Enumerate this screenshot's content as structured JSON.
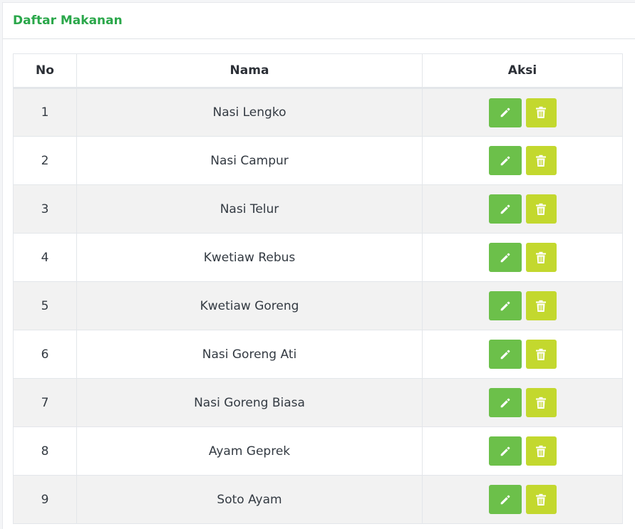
{
  "card": {
    "title": "Daftar Makanan"
  },
  "table": {
    "headers": {
      "no": "No",
      "nama": "Nama",
      "aksi": "Aksi"
    },
    "rows": [
      {
        "no": "1",
        "nama": "Nasi Lengko"
      },
      {
        "no": "2",
        "nama": "Nasi Campur"
      },
      {
        "no": "3",
        "nama": "Nasi Telur"
      },
      {
        "no": "4",
        "nama": "Kwetiaw Rebus"
      },
      {
        "no": "5",
        "nama": "Kwetiaw Goreng"
      },
      {
        "no": "6",
        "nama": "Nasi Goreng Ati"
      },
      {
        "no": "7",
        "nama": "Nasi Goreng Biasa"
      },
      {
        "no": "8",
        "nama": "Ayam Geprek"
      },
      {
        "no": "9",
        "nama": "Soto Ayam"
      }
    ]
  },
  "icons": {
    "edit": "pencil-icon",
    "delete": "trash-icon"
  },
  "colors": {
    "title": "#2aa74a",
    "edit_button": "#6cc04a",
    "delete_button": "#c3d82e",
    "row_striped": "#f2f2f2"
  }
}
